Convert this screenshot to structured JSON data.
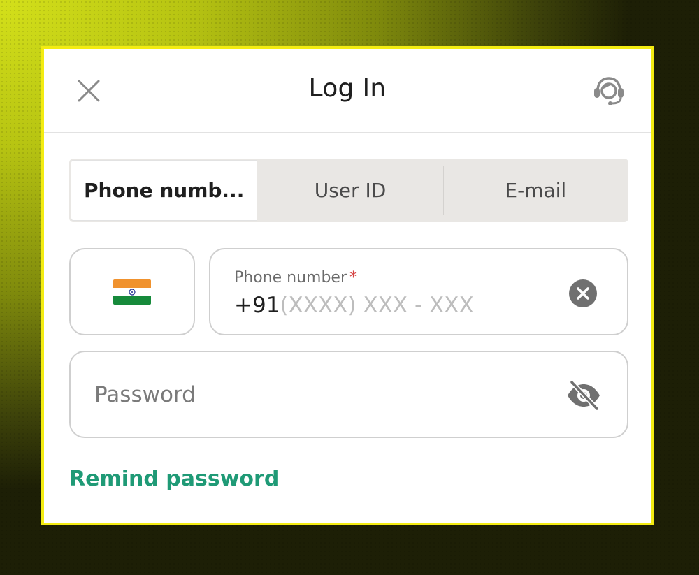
{
  "header": {
    "title": "Log In"
  },
  "tabs": [
    {
      "label": "Phone numb...",
      "active": true
    },
    {
      "label": "User ID",
      "active": false
    },
    {
      "label": "E-mail",
      "active": false
    }
  ],
  "phone": {
    "label": "Phone number",
    "required_mark": "*",
    "prefix": "+91",
    "placeholder": "(XXXX) XXX - XXX"
  },
  "password": {
    "placeholder": "Password"
  },
  "remind_password": "Remind password",
  "icons": {
    "close": "close-icon",
    "support": "support-agent-icon",
    "flag": "india-flag-icon",
    "clear": "clear-circle-icon",
    "visibility": "eye-off-icon"
  },
  "colors": {
    "accent_border": "#f3ec12",
    "link": "#1f9a76",
    "required": "#d64545"
  }
}
